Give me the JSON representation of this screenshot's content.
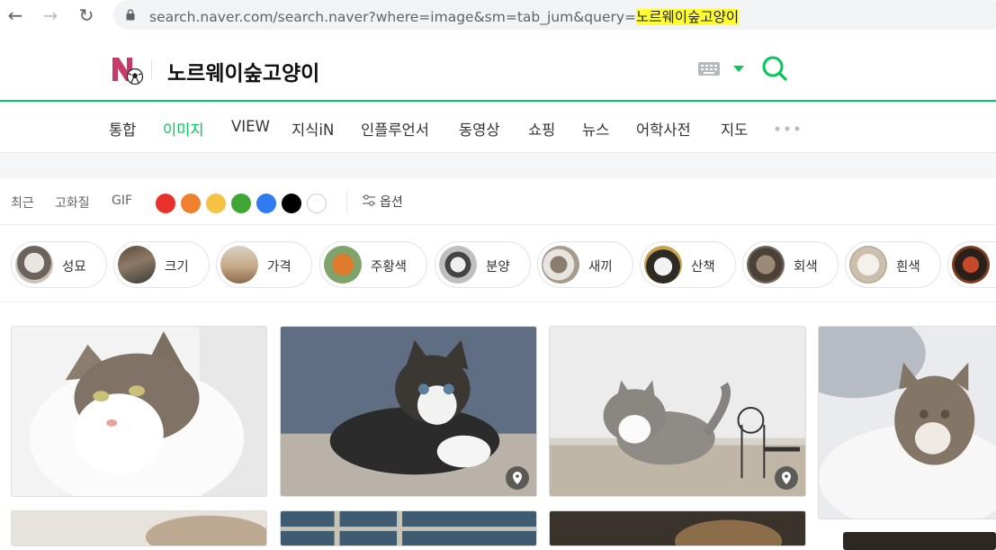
{
  "browser": {
    "url_prefix": "search.naver.com/search.naver?where=image&sm=tab_jum&query=",
    "url_query": "노르웨이숲고양이"
  },
  "header": {
    "query": "노르웨이숲고양이"
  },
  "tabs": [
    {
      "label": "통합"
    },
    {
      "label": "이미지",
      "active": true
    },
    {
      "label": "VIEW"
    },
    {
      "label": "지식iN"
    },
    {
      "label": "인플루언서"
    },
    {
      "label": "동영상"
    },
    {
      "label": "쇼핑"
    },
    {
      "label": "뉴스"
    },
    {
      "label": "어학사전"
    },
    {
      "label": "지도"
    }
  ],
  "filters": {
    "recent": "최근",
    "hd": "고화질",
    "gif": "GIF",
    "colors": [
      "#e8312a",
      "#f07f2e",
      "#f6c244",
      "#3fa535",
      "#2f7bf0",
      "#000000",
      "#ffffff"
    ],
    "options": "옵션"
  },
  "chips": [
    {
      "label": "성묘"
    },
    {
      "label": "크기"
    },
    {
      "label": "가격"
    },
    {
      "label": "주황색"
    },
    {
      "label": "분양"
    },
    {
      "label": "새끼"
    },
    {
      "label": "산책"
    },
    {
      "label": "회색"
    },
    {
      "label": "흰색"
    },
    {
      "label": ""
    }
  ],
  "icons": {
    "back": "arrow-left-icon",
    "forward": "arrow-right-icon",
    "reload": "reload-icon",
    "lock": "lock-icon",
    "keyboard": "keyboard-icon",
    "search": "search-icon",
    "more": "more-dots-icon",
    "options": "sliders-icon",
    "pin": "location-pin-icon"
  },
  "brand_color": "#03c75a"
}
